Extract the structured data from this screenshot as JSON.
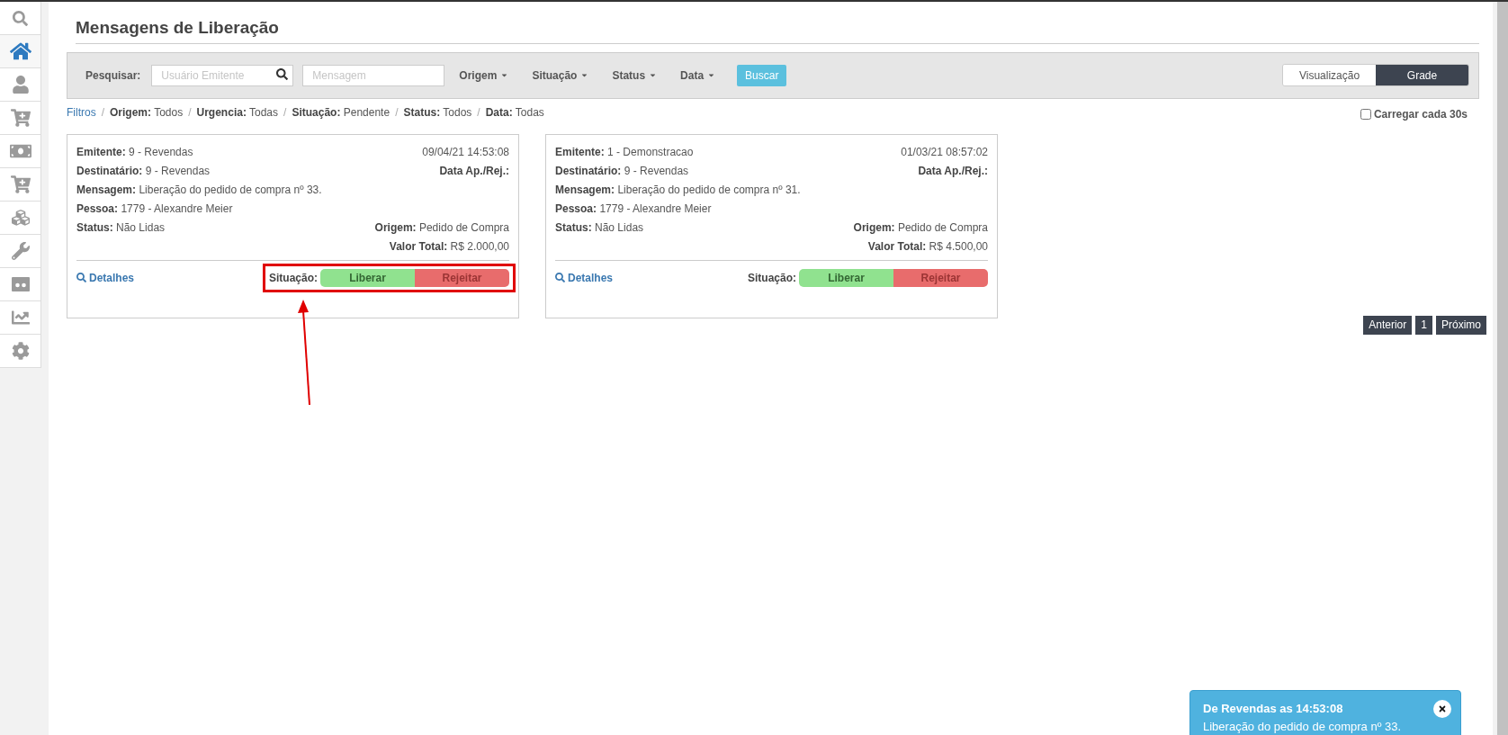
{
  "sidebar": {
    "items": [
      {
        "kind": "search",
        "selected": false
      },
      {
        "kind": "home",
        "selected": true
      },
      {
        "kind": "user",
        "selected": false
      },
      {
        "kind": "cart",
        "selected": false
      },
      {
        "kind": "money",
        "selected": false
      },
      {
        "kind": "cart",
        "selected": false
      },
      {
        "kind": "cubes",
        "selected": false
      },
      {
        "kind": "wrench",
        "selected": false
      },
      {
        "kind": "tape",
        "selected": false
      },
      {
        "kind": "chart",
        "selected": false
      },
      {
        "kind": "gear",
        "selected": false
      }
    ]
  },
  "page_title": "Mensagens de Liberação",
  "filter_bar": {
    "label": "Pesquisar:",
    "fields": [
      {
        "placeholder": "Usuário Emitente",
        "kind": "search"
      },
      {
        "placeholder": "Mensagem",
        "kind": "plain"
      }
    ],
    "dropdowns": [
      "Origem",
      "Situação",
      "Status",
      "Data"
    ],
    "search_button": "Buscar",
    "view_toggle": [
      {
        "label": "Visualização",
        "selected": false
      },
      {
        "label": "Grade",
        "selected": true
      }
    ]
  },
  "breadcrumb": {
    "link": "Filtros",
    "items": [
      {
        "separator": "/",
        "label": "Origem:",
        "value": "Todos"
      },
      {
        "separator": "/",
        "label": "Urgencia:",
        "value": "Todas"
      },
      {
        "separator": "/",
        "label": "Situação:",
        "value": "Pendente"
      },
      {
        "separator": "/",
        "label": "Status:",
        "value": "Todos"
      },
      {
        "separator": "/",
        "label": "Data:",
        "value": "Todas"
      }
    ]
  },
  "auto_reload": {
    "label": "Carregar cada 30s",
    "checked": false
  },
  "cards": [
    {
      "highlighted": true,
      "emitente": {
        "label": "Emitente:",
        "value": "9 - Revendas"
      },
      "date": "09/04/21 14:53:08",
      "destinatario": {
        "label": "Destinatário:",
        "value": "9 - Revendas"
      },
      "data_ap": "Data Ap./Rej.:",
      "mensagem": {
        "label": "Mensagem:",
        "value": "Liberação do pedido de compra nº 33."
      },
      "pessoa": {
        "label": "Pessoa:",
        "value": "1779 - Alexandre Meier"
      },
      "status": {
        "label": "Status:",
        "value": "Não Lidas"
      },
      "origem": {
        "label": "Origem:",
        "value": "Pedido de Compra"
      },
      "valor_total": {
        "label": "Valor Total:",
        "value": "R$ 2.000,00"
      },
      "details": "Detalhes",
      "situacao": "Situação:",
      "approve": "Liberar",
      "reject": "Rejeitar"
    },
    {
      "highlighted": false,
      "emitente": {
        "label": "Emitente:",
        "value": "1 - Demonstracao"
      },
      "date": "01/03/21 08:57:02",
      "destinatario": {
        "label": "Destinatário:",
        "value": "9 - Revendas"
      },
      "data_ap": "Data Ap./Rej.:",
      "mensagem": {
        "label": "Mensagem:",
        "value": "Liberação do pedido de compra nº 31."
      },
      "pessoa": {
        "label": "Pessoa:",
        "value": "1779 - Alexandre Meier"
      },
      "status": {
        "label": "Status:",
        "value": "Não Lidas"
      },
      "origem": {
        "label": "Origem:",
        "value": "Pedido de Compra"
      },
      "valor_total": {
        "label": "Valor Total:",
        "value": "R$ 4.500,00"
      },
      "details": "Detalhes",
      "situacao": "Situação:",
      "approve": "Liberar",
      "reject": "Rejeitar"
    }
  ],
  "pagination": [
    "Anterior",
    "1",
    "Próximo"
  ],
  "toast": {
    "title": "De Revendas as 14:53:08",
    "message": "Liberação do pedido de compra nº 33."
  }
}
